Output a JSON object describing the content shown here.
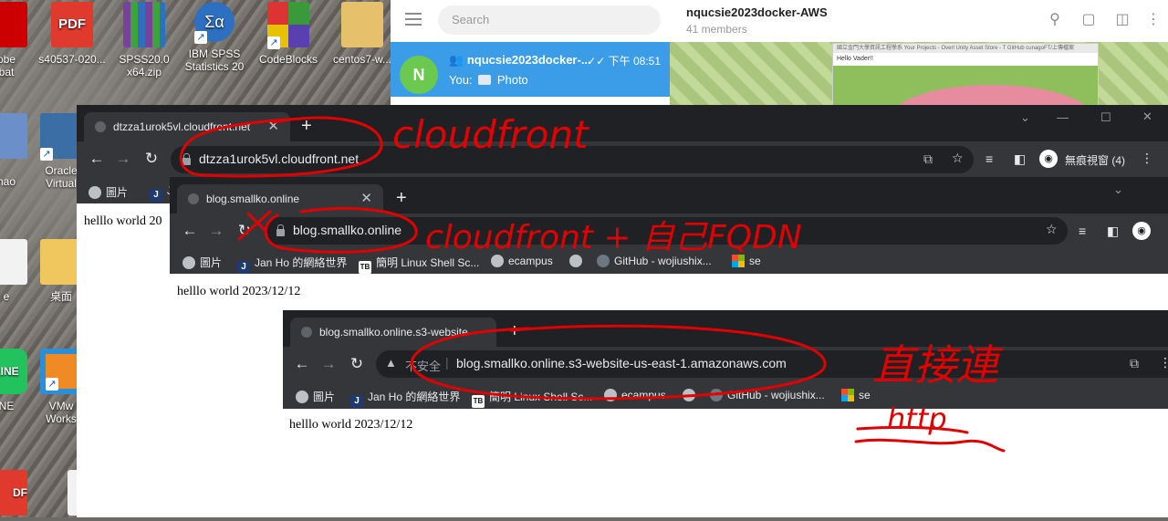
{
  "desktop": {
    "icons": [
      {
        "label": "obe\nbat",
        "color": "#c00"
      },
      {
        "label": "s40537-020...",
        "color": "#e03a2f"
      },
      {
        "label": "SPSS20.0\nx64.zip",
        "color": "#7a3fa0"
      },
      {
        "label": "IBM SPSS\nStatistics 20",
        "color": "#2d6fc1"
      },
      {
        "label": "CodeBlocks",
        "color": "#3a9a3a"
      },
      {
        "label": "centos7-w...",
        "color": "#e6c06a"
      },
      {
        "label": "Oracle\nVirtual",
        "color": "#3b6ea5"
      },
      {
        "label": "hao",
        "color": "#6a8fc9"
      },
      {
        "label": "e",
        "color": "#f2f2f2"
      },
      {
        "label": "桌面",
        "color": "#f0c75e"
      },
      {
        "label": "NE",
        "color": "#22c35e"
      },
      {
        "label": "VMw\nWorks",
        "color": "#f08a24"
      },
      {
        "label": "DF",
        "color": "#e03a2f"
      }
    ]
  },
  "telegram": {
    "search_placeholder": "Search",
    "chat": {
      "avatar": "N",
      "name": "nqucsie2023docker-...",
      "time": "下午 08:51",
      "sender": "You:",
      "message": "Photo"
    },
    "header": {
      "title": "nqucsie2023docker-AWS",
      "members": "41 members"
    },
    "photo": {
      "tabs": "國立金門大學資訊工程學系  Your Projects - Overl  Unity Asset Store - T  GitHub  cunagoFT/上傳檔案",
      "caption": "Hello Vader!!"
    }
  },
  "windows": [
    {
      "tab_title": "dtzza1urok5vl.cloudfront.net",
      "url": "dtzza1urok5vl.cloudfront.net",
      "incognito": "無痕視窗 (4)",
      "bookmarks": [
        "圖片",
        "J"
      ],
      "content": "helllo world 20"
    },
    {
      "tab_title": "blog.smallko.online",
      "url": "blog.smallko.online",
      "bookmarks": [
        "圖片",
        "Jan Ho 的網絡世界",
        "簡明 Linux Shell Sc...",
        "ecampus",
        "",
        "GitHub - wojiushix...",
        "se"
      ],
      "content": "helllo world 2023/12/12"
    },
    {
      "tab_title": "blog.smallko.online.s3-website",
      "insecure": "不安全",
      "url": "blog.smallko.online.s3-website-us-east-1.amazonaws.com",
      "bookmarks": [
        "圖片",
        "Jan Ho 的網絡世界",
        "簡明 Linux Shell Sc...",
        "ecampus",
        "",
        "GitHub - wojiushix...",
        "se"
      ],
      "content": "helllo world 2023/12/12"
    }
  ],
  "annotations": {
    "a1": "cloudfront",
    "a2": "cloudfront + 自己FQDN",
    "a3": "直接連",
    "a4": "http"
  },
  "colors": {
    "annotation_red": "#e00000",
    "telegram_blue": "#3b9ce8",
    "chrome_dark": "#202124",
    "chrome_toolbar": "#35363a"
  }
}
